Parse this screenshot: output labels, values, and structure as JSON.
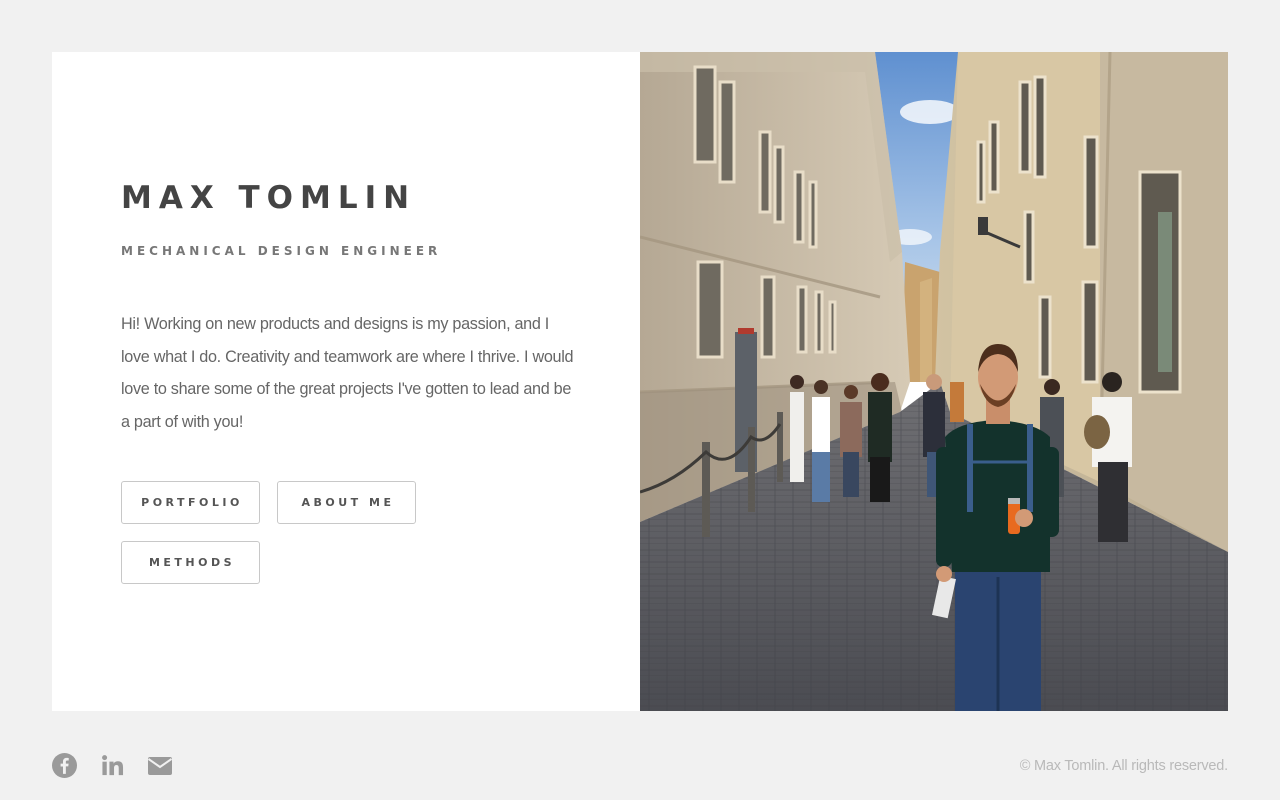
{
  "profile": {
    "name": "MAX TOMLIN",
    "title": "MECHANICAL DESIGN ENGINEER",
    "bio": "Hi! Working on new products and designs is my passion, and I love what I do. Creativity and teamwork are where I thrive. I would love to share some of the great projects I've gotten to lead and be a part of with you!"
  },
  "buttons": {
    "portfolio": "PORTFOLIO",
    "about": "ABOUT ME",
    "methods": "METHODS"
  },
  "footer": {
    "icons": [
      "facebook-icon",
      "linkedin-icon",
      "email-icon"
    ],
    "copyright": "© Max Tomlin. All rights reserved."
  },
  "colors": {
    "background": "#f1f1f1",
    "card": "#ffffff",
    "heading": "#444444",
    "text": "#666666",
    "footer": "#b9b9b9"
  }
}
